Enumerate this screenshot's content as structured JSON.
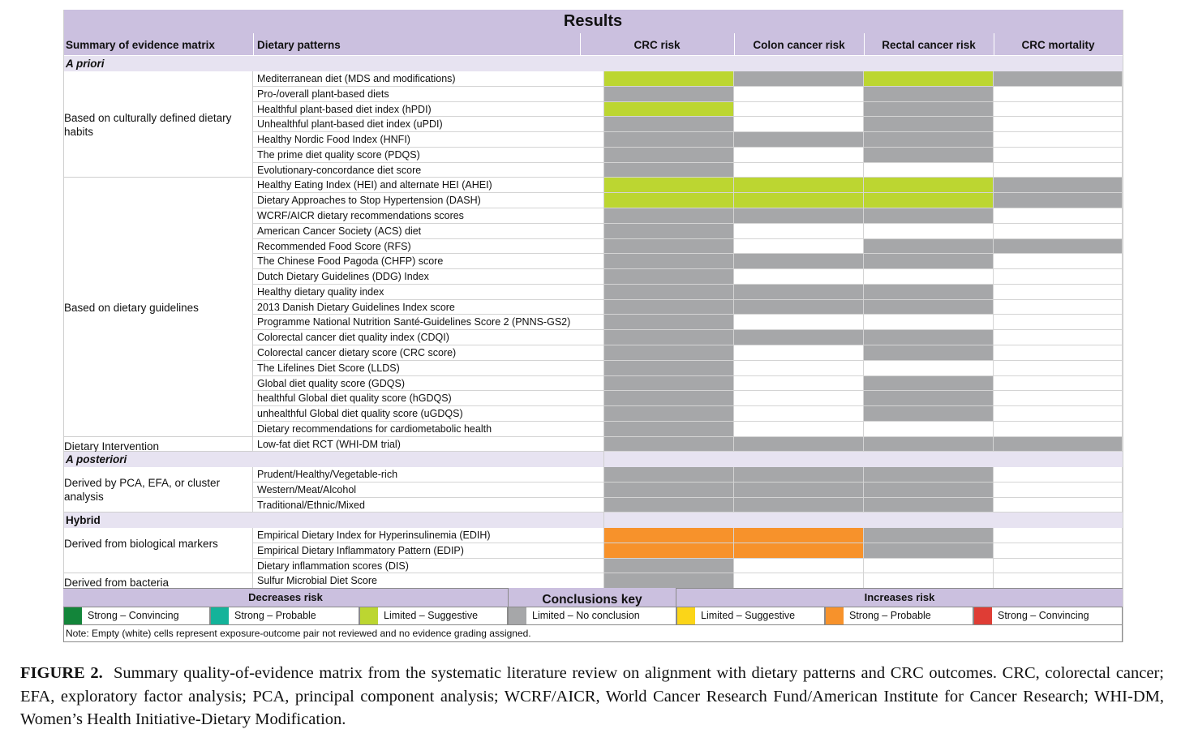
{
  "title": "Results",
  "header": {
    "summary_col": "Summary of evidence matrix",
    "pattern_col": "Dietary patterns",
    "outcomes": [
      "CRC risk",
      "Colon cancer risk",
      "Rectal cancer risk",
      "CRC mortality"
    ]
  },
  "colors": {
    "header_bg": "#cbc0df",
    "section_bg": "#e7e3f1",
    "limited_suggestive_decrease": "#bcd631",
    "no_conclusion": "#a6a7a9",
    "strong_probable_increase": "#f7922b",
    "strong_convincing_decrease": "#13853a",
    "strong_probable_decrease": "#14b39a",
    "limited_suggestive_increase": "#fbd518",
    "strong_convincing_increase": "#df3d35"
  },
  "chart_data": {
    "type": "table",
    "title": "Results",
    "columns": [
      "Summary of evidence matrix",
      "Dietary patterns",
      "CRC risk",
      "Colon cancer risk",
      "Rectal cancer risk",
      "CRC mortality"
    ],
    "code_key": {
      "L": "Limited – Suggestive (decreases risk)",
      "N": "Limited – No conclusion",
      "P": "Strong – Probable (increases risk)",
      "": "Empty (not reviewed)"
    },
    "sections": [
      {
        "label": "A priori",
        "groups": [
          {
            "label": "Based on culturally defined dietary habits",
            "rows": [
              {
                "pattern": "Mediterranean diet (MDS and modifications)",
                "crc": "L",
                "colon": "N",
                "rectal": "L",
                "mortality": "N"
              },
              {
                "pattern": "Pro-/overall plant-based diets",
                "crc": "N",
                "colon": "",
                "rectal": "N",
                "mortality": ""
              },
              {
                "pattern": "Healthful plant-based diet index (hPDI)",
                "crc": "L",
                "colon": "",
                "rectal": "N",
                "mortality": ""
              },
              {
                "pattern": "Unhealthful plant-based diet index (uPDI)",
                "crc": "N",
                "colon": "",
                "rectal": "N",
                "mortality": ""
              },
              {
                "pattern": "Healthy Nordic Food Index (HNFI)",
                "crc": "N",
                "colon": "N",
                "rectal": "N",
                "mortality": ""
              },
              {
                "pattern": "The prime diet quality score (PDQS)",
                "crc": "N",
                "colon": "",
                "rectal": "N",
                "mortality": ""
              },
              {
                "pattern": "Evolutionary-concordance diet score",
                "crc": "N",
                "colon": "",
                "rectal": "",
                "mortality": ""
              }
            ]
          },
          {
            "label": "Based on dietary guidelines",
            "rows": [
              {
                "pattern": "Healthy Eating Index (HEI) and alternate HEI (AHEI)",
                "crc": "L",
                "colon": "L",
                "rectal": "L",
                "mortality": "N"
              },
              {
                "pattern": "Dietary Approaches to Stop Hypertension (DASH)",
                "crc": "L",
                "colon": "L",
                "rectal": "L",
                "mortality": "N"
              },
              {
                "pattern": "WCRF/AICR dietary recommendations scores",
                "crc": "N",
                "colon": "N",
                "rectal": "N",
                "mortality": ""
              },
              {
                "pattern": "American Cancer Society (ACS) diet",
                "crc": "N",
                "colon": "",
                "rectal": "",
                "mortality": ""
              },
              {
                "pattern": "Recommended Food Score (RFS)",
                "crc": "N",
                "colon": "",
                "rectal": "N",
                "mortality": "N"
              },
              {
                "pattern": "The Chinese Food Pagoda (CHFP) score",
                "crc": "N",
                "colon": "N",
                "rectal": "N",
                "mortality": ""
              },
              {
                "pattern": "Dutch Dietary Guidelines (DDG) Index",
                "crc": "N",
                "colon": "",
                "rectal": "",
                "mortality": ""
              },
              {
                "pattern": "Healthy dietary quality index",
                "crc": "N",
                "colon": "N",
                "rectal": "N",
                "mortality": ""
              },
              {
                "pattern": "2013 Danish Dietary Guidelines Index score",
                "crc": "N",
                "colon": "N",
                "rectal": "N",
                "mortality": ""
              },
              {
                "pattern": "Programme National Nutrition Santé-Guidelines Score 2 (PNNS-GS2)",
                "crc": "N",
                "colon": "",
                "rectal": "",
                "mortality": ""
              },
              {
                "pattern": "Colorectal cancer diet quality index (CDQI)",
                "crc": "N",
                "colon": "N",
                "rectal": "N",
                "mortality": ""
              },
              {
                "pattern": "Colorectal cancer dietary score (CRC score)",
                "crc": "N",
                "colon": "",
                "rectal": "N",
                "mortality": ""
              },
              {
                "pattern": "The Lifelines Diet Score (LLDS)",
                "crc": "N",
                "colon": "",
                "rectal": "",
                "mortality": ""
              },
              {
                "pattern": "Global diet quality score (GDQS)",
                "crc": "N",
                "colon": "",
                "rectal": "N",
                "mortality": ""
              },
              {
                "pattern": "healthful Global diet quality score (hGDQS)",
                "crc": "N",
                "colon": "",
                "rectal": "N",
                "mortality": ""
              },
              {
                "pattern": "unhealthful Global diet quality score (uGDQS)",
                "crc": "N",
                "colon": "",
                "rectal": "N",
                "mortality": ""
              },
              {
                "pattern": "Dietary recommendations for cardiometabolic health",
                "crc": "N",
                "colon": "",
                "rectal": "",
                "mortality": ""
              }
            ]
          },
          {
            "label": "Dietary Intervention",
            "rows": [
              {
                "pattern": "Low-fat diet RCT (WHI-DM trial)",
                "crc": "N",
                "colon": "N",
                "rectal": "N",
                "mortality": "N"
              }
            ]
          }
        ]
      },
      {
        "label": "A posteriori",
        "groups": [
          {
            "label": "Derived by PCA, EFA, or cluster analysis",
            "rows": [
              {
                "pattern": "Prudent/Healthy/Vegetable-rich",
                "crc": "N",
                "colon": "N",
                "rectal": "N",
                "mortality": ""
              },
              {
                "pattern": "Western/Meat/Alcohol",
                "crc": "N",
                "colon": "N",
                "rectal": "N",
                "mortality": ""
              },
              {
                "pattern": "Traditional/Ethnic/Mixed",
                "crc": "N",
                "colon": "N",
                "rectal": "N",
                "mortality": ""
              }
            ]
          }
        ]
      },
      {
        "label": "Hybrid",
        "groups": [
          {
            "label": "Derived from biological markers",
            "rows": [
              {
                "pattern": "Empirical Dietary Index for Hyperinsulinemia (EDIH)",
                "crc": "P",
                "colon": "P",
                "rectal": "N",
                "mortality": ""
              },
              {
                "pattern": "Empirical Dietary Inflammatory Pattern (EDIP)",
                "crc": "P",
                "colon": "P",
                "rectal": "N",
                "mortality": ""
              },
              {
                "pattern": "Dietary inflammation scores (DIS)",
                "crc": "N",
                "colon": "",
                "rectal": "",
                "mortality": ""
              }
            ]
          },
          {
            "label": "Derived from bacteria",
            "rows": [
              {
                "pattern": "Sulfur Microbial Diet Score",
                "crc": "N",
                "colon": "",
                "rectal": "",
                "mortality": ""
              }
            ]
          }
        ]
      }
    ]
  },
  "legend": {
    "decreases_label": "Decreases risk",
    "key_label": "Conclusions key",
    "increases_label": "Increases risk",
    "items": [
      {
        "label": "Strong – Convincing",
        "color": "#13853a"
      },
      {
        "label": "Strong – Probable",
        "color": "#14b39a"
      },
      {
        "label": "Limited – Suggestive",
        "color": "#bcd631"
      },
      {
        "label": "Limited – No conclusion",
        "color": "#a6a7a9"
      },
      {
        "label": "Limited – Suggestive",
        "color": "#fbd518"
      },
      {
        "label": "Strong – Probable",
        "color": "#f7922b"
      },
      {
        "label": "Strong – Convincing",
        "color": "#df3d35"
      }
    ],
    "note": "Note: Empty (white) cells represent exposure-outcome pair not reviewed and no evidence grading assigned."
  },
  "caption": {
    "label": "FIGURE 2.",
    "text": "Summary quality-of-evidence matrix from the systematic literature review on alignment with dietary patterns and CRC outcomes. CRC, colorectal cancer; EFA, exploratory factor analysis; PCA, principal component analysis; WCRF/AICR, World Cancer Research Fund/American Institute for Cancer Research; WHI-DM, Women’s Health Initiative-Dietary Modification."
  }
}
